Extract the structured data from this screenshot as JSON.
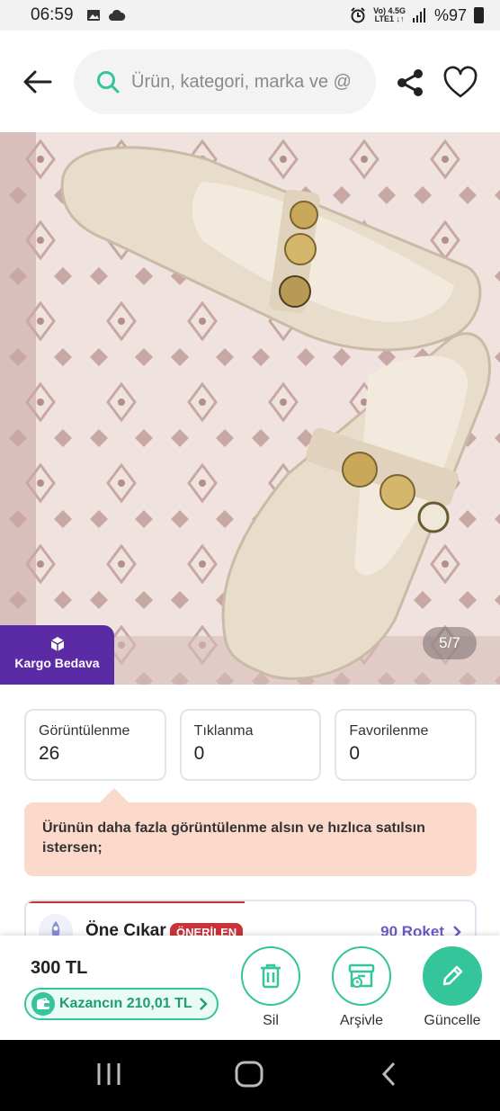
{
  "status_bar": {
    "time": "06:59",
    "network_top": "Vo) 4.5G",
    "network_bottom": "LTE1 ↓↑",
    "battery": "%97"
  },
  "header": {
    "search_placeholder": "Ürün, kategori, marka ve @"
  },
  "listing": {
    "shipping_badge": "Kargo Bedava",
    "image_counter": "5/7"
  },
  "stats": [
    {
      "label": "Görüntülenme",
      "value": "26"
    },
    {
      "label": "Tıklanma",
      "value": "0"
    },
    {
      "label": "Favorilenme",
      "value": "0"
    }
  ],
  "tip": {
    "text": "Ürünün daha fazla görüntülenme alsın ve hızlıca satılsın istersen;"
  },
  "boost": {
    "title": "Öne Çıkar",
    "badge": "ÖNERİLEN",
    "rocket_count": "90 Roket"
  },
  "bottom": {
    "price": "300 TL",
    "earnings": "Kazancın 210,01 TL",
    "actions": {
      "delete": "Sil",
      "archive": "Arşivle",
      "update": "Güncelle"
    }
  },
  "colors": {
    "accent_green": "#35c59b",
    "brand_purple": "#5b2aa5",
    "badge_red": "#c9343a",
    "tip_bg": "#fbd9cb"
  }
}
